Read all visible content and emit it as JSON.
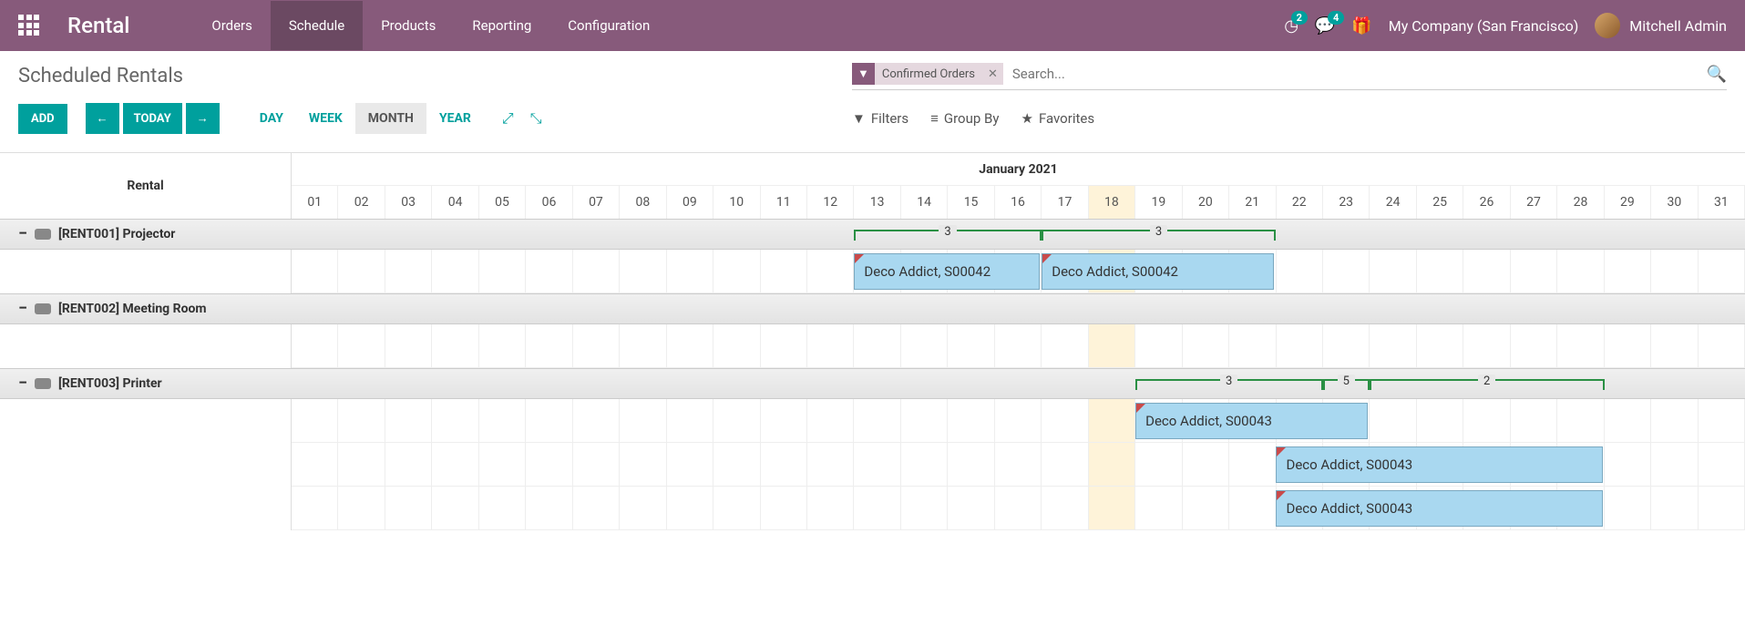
{
  "brand": "Rental",
  "nav": {
    "items": [
      "Orders",
      "Schedule",
      "Products",
      "Reporting",
      "Configuration"
    ],
    "active_index": 1,
    "clock_badge": "2",
    "chat_badge": "4",
    "company": "My Company (San Francisco)",
    "user": "Mitchell Admin"
  },
  "page_title": "Scheduled Rentals",
  "search": {
    "filter_tag": "Confirmed Orders",
    "placeholder": "Search..."
  },
  "controls": {
    "add": "ADD",
    "today": "TODAY",
    "views": [
      "DAY",
      "WEEK",
      "MONTH",
      "YEAR"
    ],
    "active_view": 2,
    "filters": "Filters",
    "group_by": "Group By",
    "favorites": "Favorites"
  },
  "gantt": {
    "left_header": "Rental",
    "month_label": "January 2021",
    "days": [
      "01",
      "02",
      "03",
      "04",
      "05",
      "06",
      "07",
      "08",
      "09",
      "10",
      "11",
      "12",
      "13",
      "14",
      "15",
      "16",
      "17",
      "18",
      "19",
      "20",
      "21",
      "22",
      "23",
      "24",
      "25",
      "26",
      "27",
      "28",
      "29",
      "30",
      "31"
    ],
    "today_index": 17,
    "groups": [
      {
        "label": "[RENT001] Projector",
        "braces": [
          {
            "start_day_idx": 12,
            "span": 4,
            "label": "3"
          },
          {
            "start_day_idx": 16,
            "span": 5,
            "label": "3"
          }
        ],
        "rows": [
          [
            {
              "start_day_idx": 12,
              "span": 4,
              "label": "Deco Addict, S00042"
            },
            {
              "start_day_idx": 16,
              "span": 5,
              "label": "Deco Addict, S00042"
            }
          ]
        ]
      },
      {
        "label": "[RENT002] Meeting Room",
        "braces": [],
        "rows": [
          []
        ]
      },
      {
        "label": "[RENT003] Printer",
        "braces": [
          {
            "start_day_idx": 18,
            "span": 4,
            "label": "3"
          },
          {
            "start_day_idx": 22,
            "span": 1,
            "label": "5"
          },
          {
            "start_day_idx": 23,
            "span": 5,
            "label": "2"
          }
        ],
        "rows": [
          [
            {
              "start_day_idx": 18,
              "span": 5,
              "label": "Deco Addict, S00043"
            }
          ],
          [
            {
              "start_day_idx": 21,
              "span": 7,
              "label": "Deco Addict, S00043"
            }
          ],
          [
            {
              "start_day_idx": 21,
              "span": 7,
              "label": "Deco Addict, S00043"
            }
          ]
        ]
      }
    ]
  }
}
